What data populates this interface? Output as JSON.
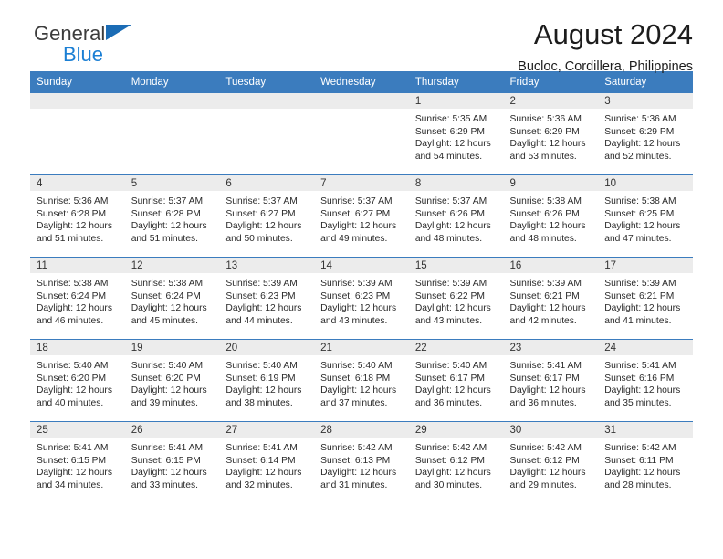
{
  "brand": {
    "name_part1": "General",
    "name_part2": "Blue",
    "logo_icon": "triangle-flag-icon",
    "accent_color": "#1b7fd4"
  },
  "header": {
    "month_title": "August 2024",
    "location": "Bucloc, Cordillera, Philippines"
  },
  "theme": {
    "header_blue": "#3b7cbe",
    "daynum_band": "#ececec",
    "text": "#2a2a2a"
  },
  "weekday_headers": [
    "Sunday",
    "Monday",
    "Tuesday",
    "Wednesday",
    "Thursday",
    "Friday",
    "Saturday"
  ],
  "labels": {
    "sunrise": "Sunrise:",
    "sunset": "Sunset:",
    "daylight": "Daylight:"
  },
  "weeks": [
    [
      {
        "day": "",
        "blank": true,
        "sunrise": "",
        "sunset": "",
        "daylight_1": "",
        "daylight_2": ""
      },
      {
        "day": "",
        "blank": true,
        "sunrise": "",
        "sunset": "",
        "daylight_1": "",
        "daylight_2": ""
      },
      {
        "day": "",
        "blank": true,
        "sunrise": "",
        "sunset": "",
        "daylight_1": "",
        "daylight_2": ""
      },
      {
        "day": "",
        "blank": true,
        "sunrise": "",
        "sunset": "",
        "daylight_1": "",
        "daylight_2": ""
      },
      {
        "day": "1",
        "blank": false,
        "sunrise": "Sunrise: 5:35 AM",
        "sunset": "Sunset: 6:29 PM",
        "daylight_1": "Daylight: 12 hours",
        "daylight_2": "and 54 minutes."
      },
      {
        "day": "2",
        "blank": false,
        "sunrise": "Sunrise: 5:36 AM",
        "sunset": "Sunset: 6:29 PM",
        "daylight_1": "Daylight: 12 hours",
        "daylight_2": "and 53 minutes."
      },
      {
        "day": "3",
        "blank": false,
        "sunrise": "Sunrise: 5:36 AM",
        "sunset": "Sunset: 6:29 PM",
        "daylight_1": "Daylight: 12 hours",
        "daylight_2": "and 52 minutes."
      }
    ],
    [
      {
        "day": "4",
        "blank": false,
        "sunrise": "Sunrise: 5:36 AM",
        "sunset": "Sunset: 6:28 PM",
        "daylight_1": "Daylight: 12 hours",
        "daylight_2": "and 51 minutes."
      },
      {
        "day": "5",
        "blank": false,
        "sunrise": "Sunrise: 5:37 AM",
        "sunset": "Sunset: 6:28 PM",
        "daylight_1": "Daylight: 12 hours",
        "daylight_2": "and 51 minutes."
      },
      {
        "day": "6",
        "blank": false,
        "sunrise": "Sunrise: 5:37 AM",
        "sunset": "Sunset: 6:27 PM",
        "daylight_1": "Daylight: 12 hours",
        "daylight_2": "and 50 minutes."
      },
      {
        "day": "7",
        "blank": false,
        "sunrise": "Sunrise: 5:37 AM",
        "sunset": "Sunset: 6:27 PM",
        "daylight_1": "Daylight: 12 hours",
        "daylight_2": "and 49 minutes."
      },
      {
        "day": "8",
        "blank": false,
        "sunrise": "Sunrise: 5:37 AM",
        "sunset": "Sunset: 6:26 PM",
        "daylight_1": "Daylight: 12 hours",
        "daylight_2": "and 48 minutes."
      },
      {
        "day": "9",
        "blank": false,
        "sunrise": "Sunrise: 5:38 AM",
        "sunset": "Sunset: 6:26 PM",
        "daylight_1": "Daylight: 12 hours",
        "daylight_2": "and 48 minutes."
      },
      {
        "day": "10",
        "blank": false,
        "sunrise": "Sunrise: 5:38 AM",
        "sunset": "Sunset: 6:25 PM",
        "daylight_1": "Daylight: 12 hours",
        "daylight_2": "and 47 minutes."
      }
    ],
    [
      {
        "day": "11",
        "blank": false,
        "sunrise": "Sunrise: 5:38 AM",
        "sunset": "Sunset: 6:24 PM",
        "daylight_1": "Daylight: 12 hours",
        "daylight_2": "and 46 minutes."
      },
      {
        "day": "12",
        "blank": false,
        "sunrise": "Sunrise: 5:38 AM",
        "sunset": "Sunset: 6:24 PM",
        "daylight_1": "Daylight: 12 hours",
        "daylight_2": "and 45 minutes."
      },
      {
        "day": "13",
        "blank": false,
        "sunrise": "Sunrise: 5:39 AM",
        "sunset": "Sunset: 6:23 PM",
        "daylight_1": "Daylight: 12 hours",
        "daylight_2": "and 44 minutes."
      },
      {
        "day": "14",
        "blank": false,
        "sunrise": "Sunrise: 5:39 AM",
        "sunset": "Sunset: 6:23 PM",
        "daylight_1": "Daylight: 12 hours",
        "daylight_2": "and 43 minutes."
      },
      {
        "day": "15",
        "blank": false,
        "sunrise": "Sunrise: 5:39 AM",
        "sunset": "Sunset: 6:22 PM",
        "daylight_1": "Daylight: 12 hours",
        "daylight_2": "and 43 minutes."
      },
      {
        "day": "16",
        "blank": false,
        "sunrise": "Sunrise: 5:39 AM",
        "sunset": "Sunset: 6:21 PM",
        "daylight_1": "Daylight: 12 hours",
        "daylight_2": "and 42 minutes."
      },
      {
        "day": "17",
        "blank": false,
        "sunrise": "Sunrise: 5:39 AM",
        "sunset": "Sunset: 6:21 PM",
        "daylight_1": "Daylight: 12 hours",
        "daylight_2": "and 41 minutes."
      }
    ],
    [
      {
        "day": "18",
        "blank": false,
        "sunrise": "Sunrise: 5:40 AM",
        "sunset": "Sunset: 6:20 PM",
        "daylight_1": "Daylight: 12 hours",
        "daylight_2": "and 40 minutes."
      },
      {
        "day": "19",
        "blank": false,
        "sunrise": "Sunrise: 5:40 AM",
        "sunset": "Sunset: 6:20 PM",
        "daylight_1": "Daylight: 12 hours",
        "daylight_2": "and 39 minutes."
      },
      {
        "day": "20",
        "blank": false,
        "sunrise": "Sunrise: 5:40 AM",
        "sunset": "Sunset: 6:19 PM",
        "daylight_1": "Daylight: 12 hours",
        "daylight_2": "and 38 minutes."
      },
      {
        "day": "21",
        "blank": false,
        "sunrise": "Sunrise: 5:40 AM",
        "sunset": "Sunset: 6:18 PM",
        "daylight_1": "Daylight: 12 hours",
        "daylight_2": "and 37 minutes."
      },
      {
        "day": "22",
        "blank": false,
        "sunrise": "Sunrise: 5:40 AM",
        "sunset": "Sunset: 6:17 PM",
        "daylight_1": "Daylight: 12 hours",
        "daylight_2": "and 36 minutes."
      },
      {
        "day": "23",
        "blank": false,
        "sunrise": "Sunrise: 5:41 AM",
        "sunset": "Sunset: 6:17 PM",
        "daylight_1": "Daylight: 12 hours",
        "daylight_2": "and 36 minutes."
      },
      {
        "day": "24",
        "blank": false,
        "sunrise": "Sunrise: 5:41 AM",
        "sunset": "Sunset: 6:16 PM",
        "daylight_1": "Daylight: 12 hours",
        "daylight_2": "and 35 minutes."
      }
    ],
    [
      {
        "day": "25",
        "blank": false,
        "sunrise": "Sunrise: 5:41 AM",
        "sunset": "Sunset: 6:15 PM",
        "daylight_1": "Daylight: 12 hours",
        "daylight_2": "and 34 minutes."
      },
      {
        "day": "26",
        "blank": false,
        "sunrise": "Sunrise: 5:41 AM",
        "sunset": "Sunset: 6:15 PM",
        "daylight_1": "Daylight: 12 hours",
        "daylight_2": "and 33 minutes."
      },
      {
        "day": "27",
        "blank": false,
        "sunrise": "Sunrise: 5:41 AM",
        "sunset": "Sunset: 6:14 PM",
        "daylight_1": "Daylight: 12 hours",
        "daylight_2": "and 32 minutes."
      },
      {
        "day": "28",
        "blank": false,
        "sunrise": "Sunrise: 5:42 AM",
        "sunset": "Sunset: 6:13 PM",
        "daylight_1": "Daylight: 12 hours",
        "daylight_2": "and 31 minutes."
      },
      {
        "day": "29",
        "blank": false,
        "sunrise": "Sunrise: 5:42 AM",
        "sunset": "Sunset: 6:12 PM",
        "daylight_1": "Daylight: 12 hours",
        "daylight_2": "and 30 minutes."
      },
      {
        "day": "30",
        "blank": false,
        "sunrise": "Sunrise: 5:42 AM",
        "sunset": "Sunset: 6:12 PM",
        "daylight_1": "Daylight: 12 hours",
        "daylight_2": "and 29 minutes."
      },
      {
        "day": "31",
        "blank": false,
        "sunrise": "Sunrise: 5:42 AM",
        "sunset": "Sunset: 6:11 PM",
        "daylight_1": "Daylight: 12 hours",
        "daylight_2": "and 28 minutes."
      }
    ]
  ]
}
